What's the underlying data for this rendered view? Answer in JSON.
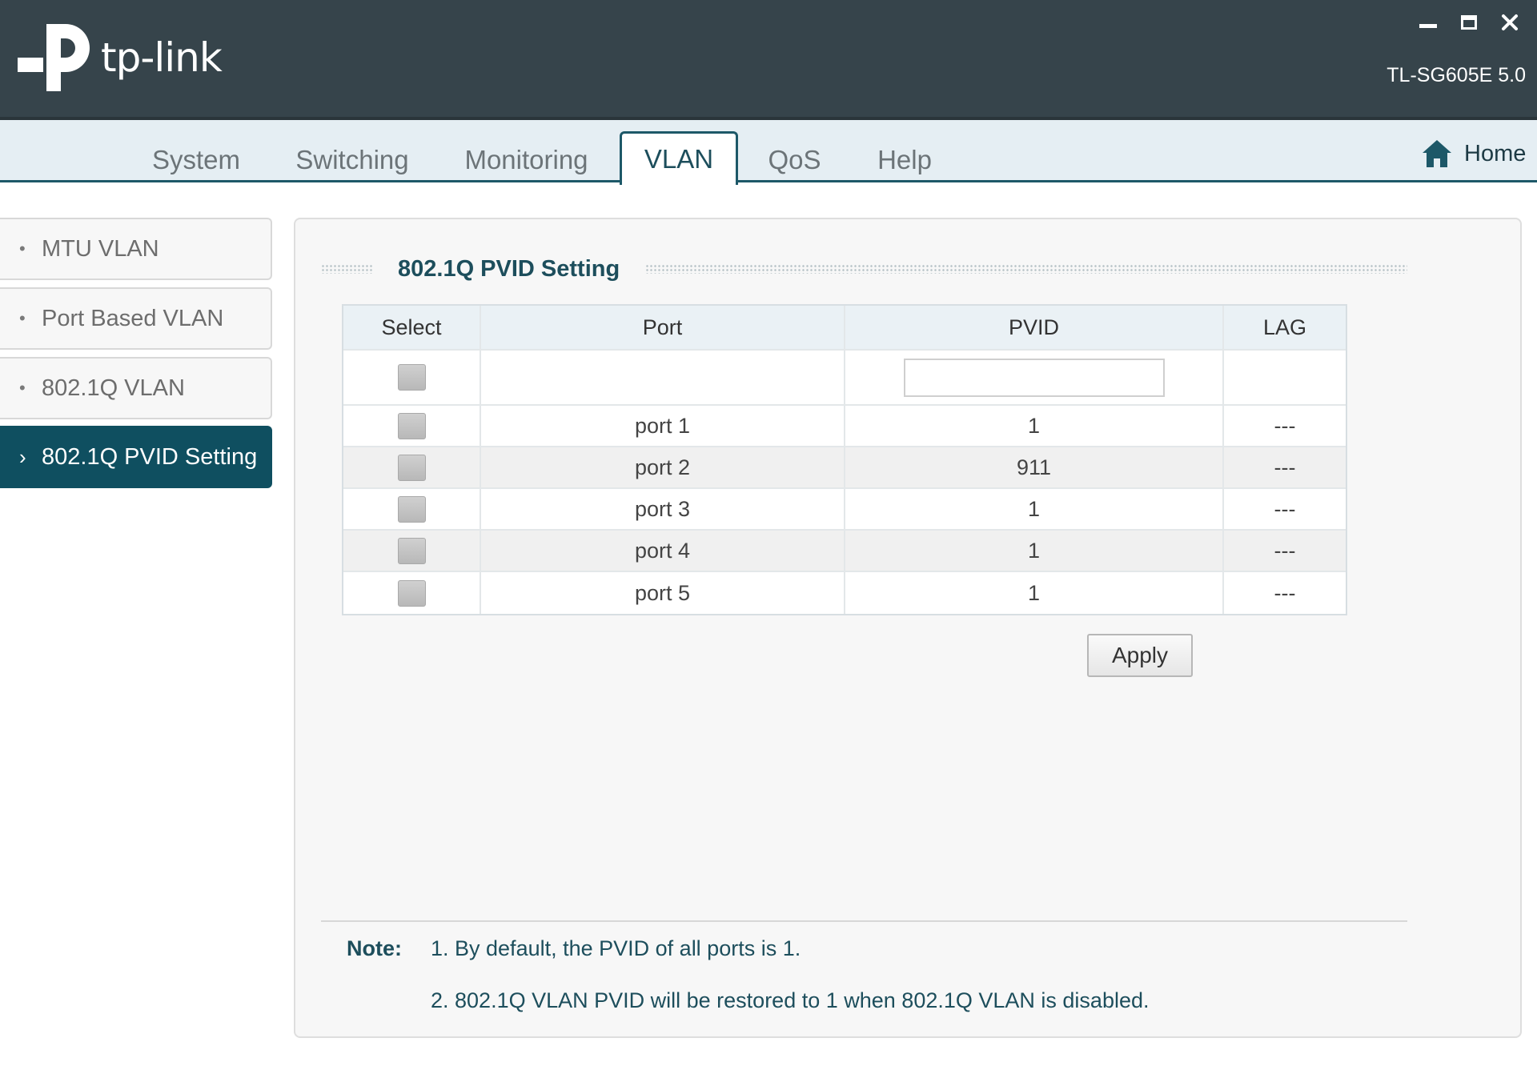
{
  "header": {
    "logo_text": "tp-link",
    "model": "TL-SG605E 5.0",
    "window_controls": [
      "minimize-icon",
      "maximize-icon",
      "close-icon"
    ]
  },
  "nav": {
    "tabs": [
      {
        "label": "System"
      },
      {
        "label": "Switching"
      },
      {
        "label": "Monitoring"
      },
      {
        "label": "VLAN",
        "active": true
      },
      {
        "label": "QoS"
      },
      {
        "label": "Help"
      }
    ],
    "home_label": "Home"
  },
  "sidebar": {
    "items": [
      {
        "label": "MTU VLAN",
        "bullet": "•"
      },
      {
        "label": "Port Based VLAN",
        "bullet": "•"
      },
      {
        "label": "802.1Q VLAN",
        "bullet": "•"
      },
      {
        "label": "802.1Q PVID Setting",
        "bullet": "›",
        "active": true
      }
    ]
  },
  "main": {
    "title": "802.1Q PVID Setting",
    "table": {
      "headers": [
        "Select",
        "Port",
        "PVID",
        "LAG"
      ],
      "filter": {
        "pvid_value": ""
      },
      "rows": [
        {
          "port": "port 1",
          "pvid": "1",
          "lag": "---"
        },
        {
          "port": "port 2",
          "pvid": "911",
          "lag": "---"
        },
        {
          "port": "port 3",
          "pvid": "1",
          "lag": "---"
        },
        {
          "port": "port 4",
          "pvid": "1",
          "lag": "---"
        },
        {
          "port": "port 5",
          "pvid": "1",
          "lag": "---"
        }
      ]
    },
    "apply_label": "Apply",
    "note": {
      "label": "Note:",
      "lines": [
        "1. By default, the PVID of all ports is 1.",
        "2. 802.1Q VLAN PVID will be restored to 1 when 802.1Q VLAN is disabled."
      ]
    }
  },
  "colors": {
    "header_bg": "#36444b",
    "accent": "#1d5868",
    "active_sidebar": "#0f4f60",
    "text_teal": "#1d4e5c"
  }
}
